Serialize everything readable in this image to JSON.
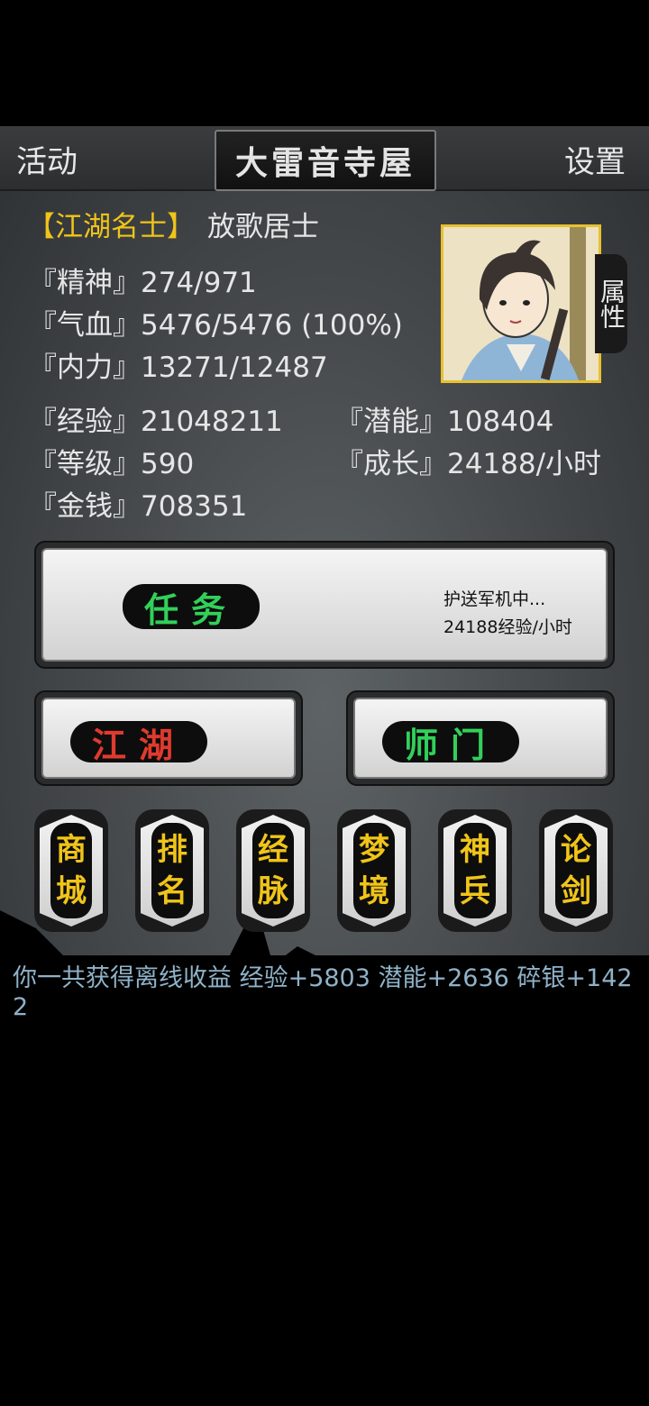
{
  "topbar": {
    "left_label": "活动",
    "title": "大雷音寺屋",
    "right_label": "设置"
  },
  "player": {
    "rank_title": "【江湖名士】",
    "name": "放歌居士",
    "attr_tab_label": "属性"
  },
  "stats": {
    "spirit": "『精神』274/971",
    "blood": "『气血』5476/5476 (100%)",
    "energy": "『内力』13271/12487",
    "exp": "『经验』21048211",
    "potential": "『潜能』108404",
    "level": "『等级』590",
    "growth": "『成长』24188/小时",
    "money": "『金钱』708351"
  },
  "task": {
    "label": "任务",
    "status": "护送军机中...",
    "rate": "24188经验/小时"
  },
  "big_buttons": {
    "jianghu": "江湖",
    "shimen": "师门"
  },
  "small_buttons": [
    {
      "label": "商城"
    },
    {
      "label": "排名"
    },
    {
      "label": "经脉"
    },
    {
      "label": "梦境"
    },
    {
      "label": "神兵"
    },
    {
      "label": "论剑"
    }
  ],
  "log": {
    "message": "你一共获得离线收益 经验+5803 潜能+2636 碎银+1422"
  },
  "colors": {
    "accent_yellow": "#f0c419",
    "task_green": "#32d05a",
    "jianghu_red": "#e03a2e",
    "log_blue": "#8fb2c8"
  }
}
